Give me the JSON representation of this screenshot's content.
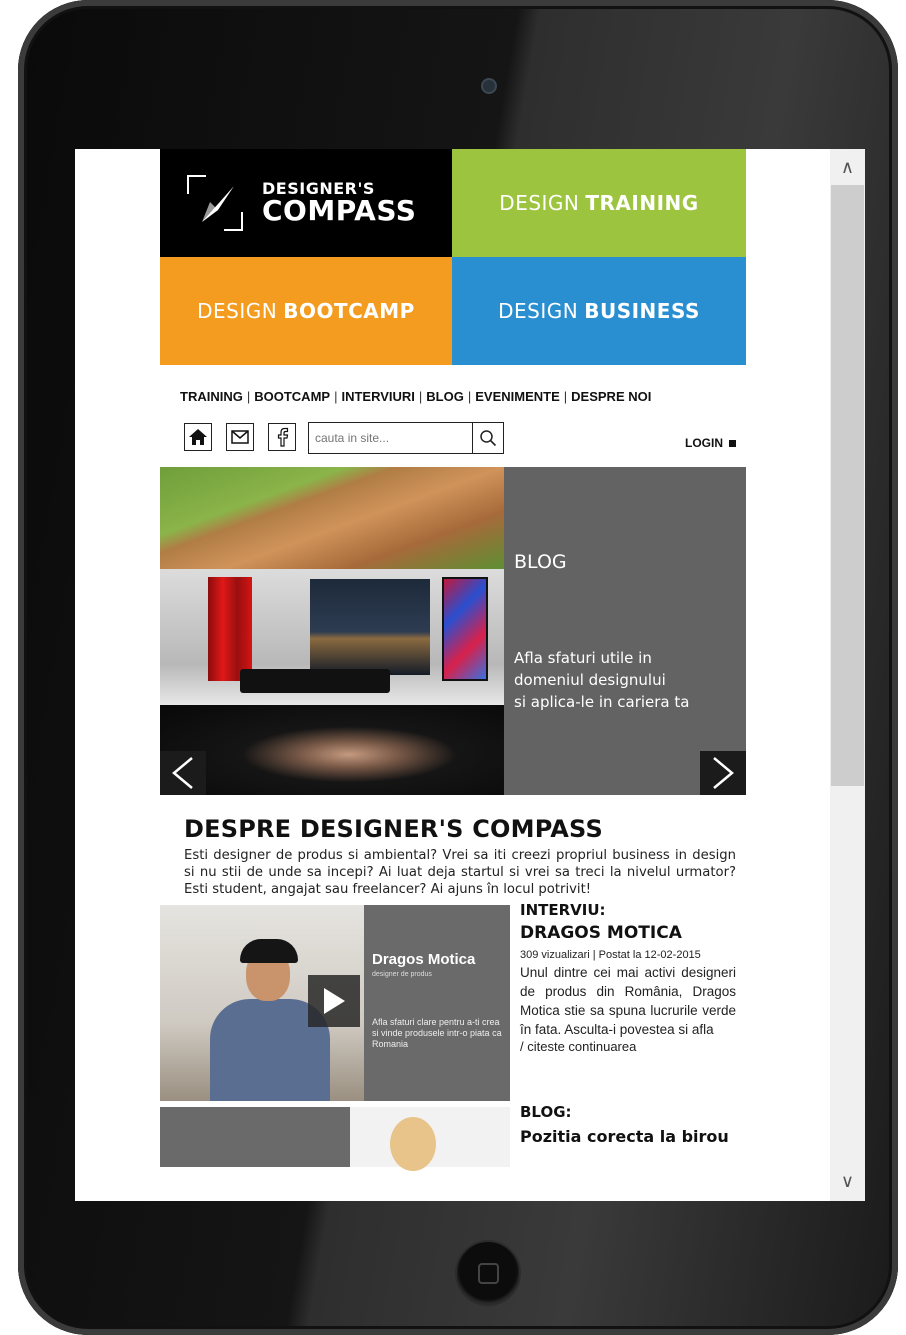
{
  "brand": {
    "line1": "DESIGNER'S",
    "line2": "COMPASS"
  },
  "tiles": {
    "training": {
      "light": "DESIGN",
      "bold": "TRAINING",
      "color": "#9dc43e"
    },
    "bootcamp": {
      "light": "DESIGN",
      "bold": "BOOTCAMP",
      "color": "#f39c1f"
    },
    "business": {
      "light": "DESIGN",
      "bold": "BUSINESS",
      "color": "#2a8fd1"
    }
  },
  "nav": {
    "items": [
      "TRAINING",
      "BOOTCAMP",
      "INTERVIURI",
      "BLOG",
      "EVENIMENTE",
      "DESPRE NOI"
    ],
    "separator": "|"
  },
  "toolbar": {
    "icons": [
      "home-icon",
      "mail-icon",
      "facebook-icon"
    ],
    "search_placeholder": "cauta in site...",
    "login_label": "LOGIN"
  },
  "slider": {
    "title": "BLOG",
    "description_lines": [
      "Afla sfaturi utile in",
      "domeniul designului",
      "si aplica-le in cariera ta"
    ],
    "prev_label": "<",
    "next_label": ">"
  },
  "about": {
    "heading": "DESPRE DESIGNER'S COMPASS",
    "text": "Esti designer de produs si ambiental? Vrei sa iti creezi propriul business in design si nu stii de unde sa incepi? Ai luat deja startul si vrei sa treci la nivelul urmator? Esti student, angajat sau freelancer? Ai ajuns în locul potrivit!"
  },
  "articles": [
    {
      "kicker": "INTERVIU:",
      "title": "DRAGOS MOTICA",
      "meta": "309 vizualizari | Postat la 12-02-2015",
      "desc": "Unul dintre cei mai activi designeri de produs din România, Dragos Motica stie sa spuna lucrurile verde în fata. Asculta-i povestea si afla",
      "more": "/ citeste continuarea",
      "thumb_name": "Dragos Motica",
      "thumb_sub": "designer de produs",
      "thumb_tag": "Afla sfaturi clare pentru a-ti crea si vinde produsele intr-o piata ca Romania"
    },
    {
      "kicker": "BLOG:",
      "title": "Pozitia corecta la birou"
    }
  ],
  "scrollbar": {
    "up": "∧",
    "down": "∨"
  },
  "colors": {
    "slider_panel": "#636363",
    "logo_bg": "#000000"
  }
}
